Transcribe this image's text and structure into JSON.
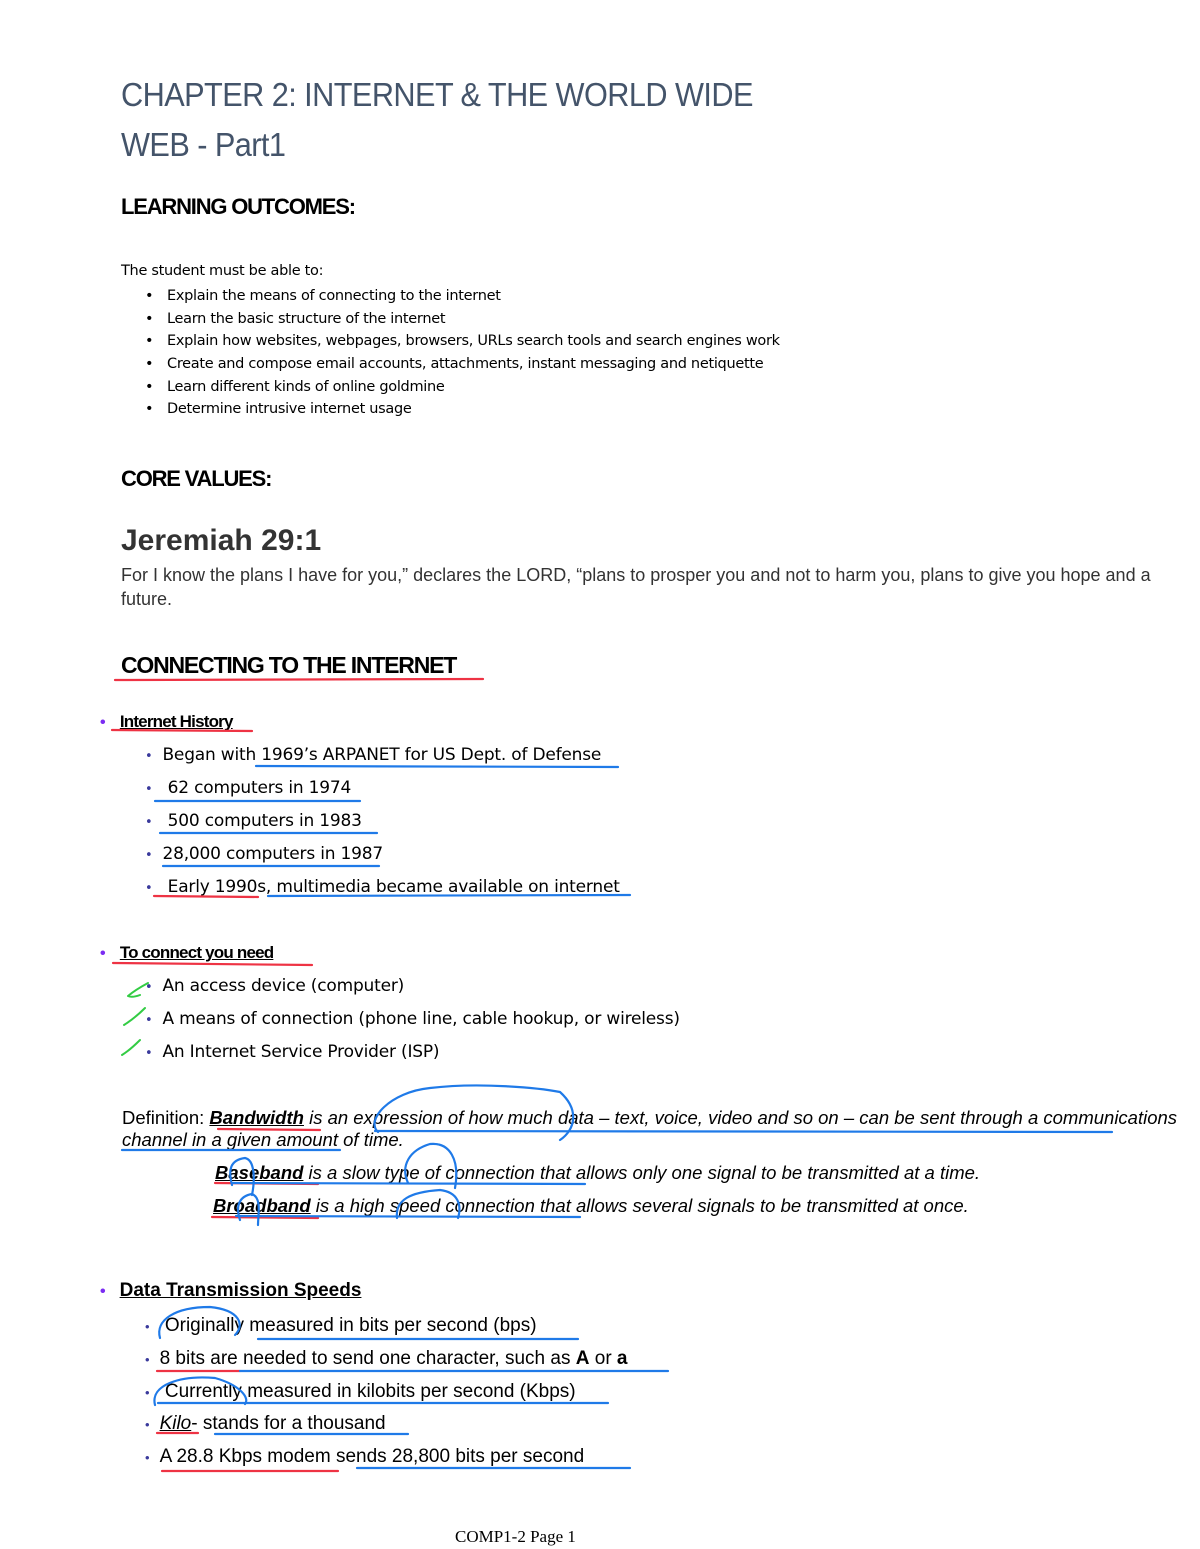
{
  "document": {
    "title_line1": "CHAPTER 2: INTERNET & THE WORLD WIDE",
    "title_line2": "WEB  - Part1",
    "learning_outcomes": {
      "heading": "LEARNING OUTCOMES:",
      "intro": "The student must be able to:",
      "items": [
        "Explain the means of connecting to the internet",
        "Learn the basic structure of the internet",
        "Explain how websites, webpages, browsers, URLs search tools and search engines work",
        "Create and compose email accounts, attachments, instant messaging and netiquette",
        "Learn different kinds of online goldmine",
        "Determine intrusive internet usage"
      ]
    },
    "core_values": {
      "heading": "CORE VALUES:",
      "verse_ref": "Jeremiah 29:1",
      "verse_text": " For I know the plans I have for you,” declares the LORD, “plans to prosper you and not to harm you, plans to give you hope and a future."
    },
    "connecting": {
      "heading": "CONNECTING TO THE INTERNET",
      "history": {
        "label": "Internet History",
        "items": [
          "Began with 1969’s ARPANET for US Dept. of Defense",
          " 62 computers in 1974",
          " 500 computers in 1983",
          "28,000 computers in 1987",
          " Early 1990s, multimedia became available on internet"
        ]
      },
      "need": {
        "label": "To connect you need ",
        "items": [
          "An access device (computer)",
          "A means of connection (phone line, cable hookup, or wireless)",
          "An Internet Service Provider (ISP)"
        ]
      },
      "definition": {
        "prefix": "Definition: ",
        "term": "Bandwidth",
        "text": " is an expression of how much data – text, voice, video and so on – can be sent through a communications channel in a given amount of time."
      },
      "baseband": {
        "term": "Baseband",
        "text": " is a slow type of connection that allows only one signal to be transmitted at a time."
      },
      "broadband": {
        "term": "Broadband",
        "text": " is a high speed connection that allows several signals to be transmitted at once."
      },
      "speeds": {
        "label": "Data Transmission Speeds",
        "items": [
          {
            "text": " Originally measured in bits per second (bps) "
          },
          {
            "text": "8 bits are needed to send one character, such as ",
            "bold1": "A",
            "mid": " or ",
            "bold2": "a"
          },
          {
            "text": " Currently measured in kilobits per second (Kbps) "
          },
          {
            "italic": "Kilo",
            "text": "- stands for a thousand"
          },
          {
            "text": "A 28.8 Kbps modem sends 28,800 bits per second "
          }
        ]
      }
    },
    "footer": "COMP1-2 Page 1",
    "annotation_colors": {
      "red": "#ee3344",
      "blue": "#1f7ae8",
      "green": "#33cc44",
      "bullet_purple": "#7b2cf2",
      "bullet_navy": "#3a3a9c",
      "title": "#44546a"
    }
  }
}
